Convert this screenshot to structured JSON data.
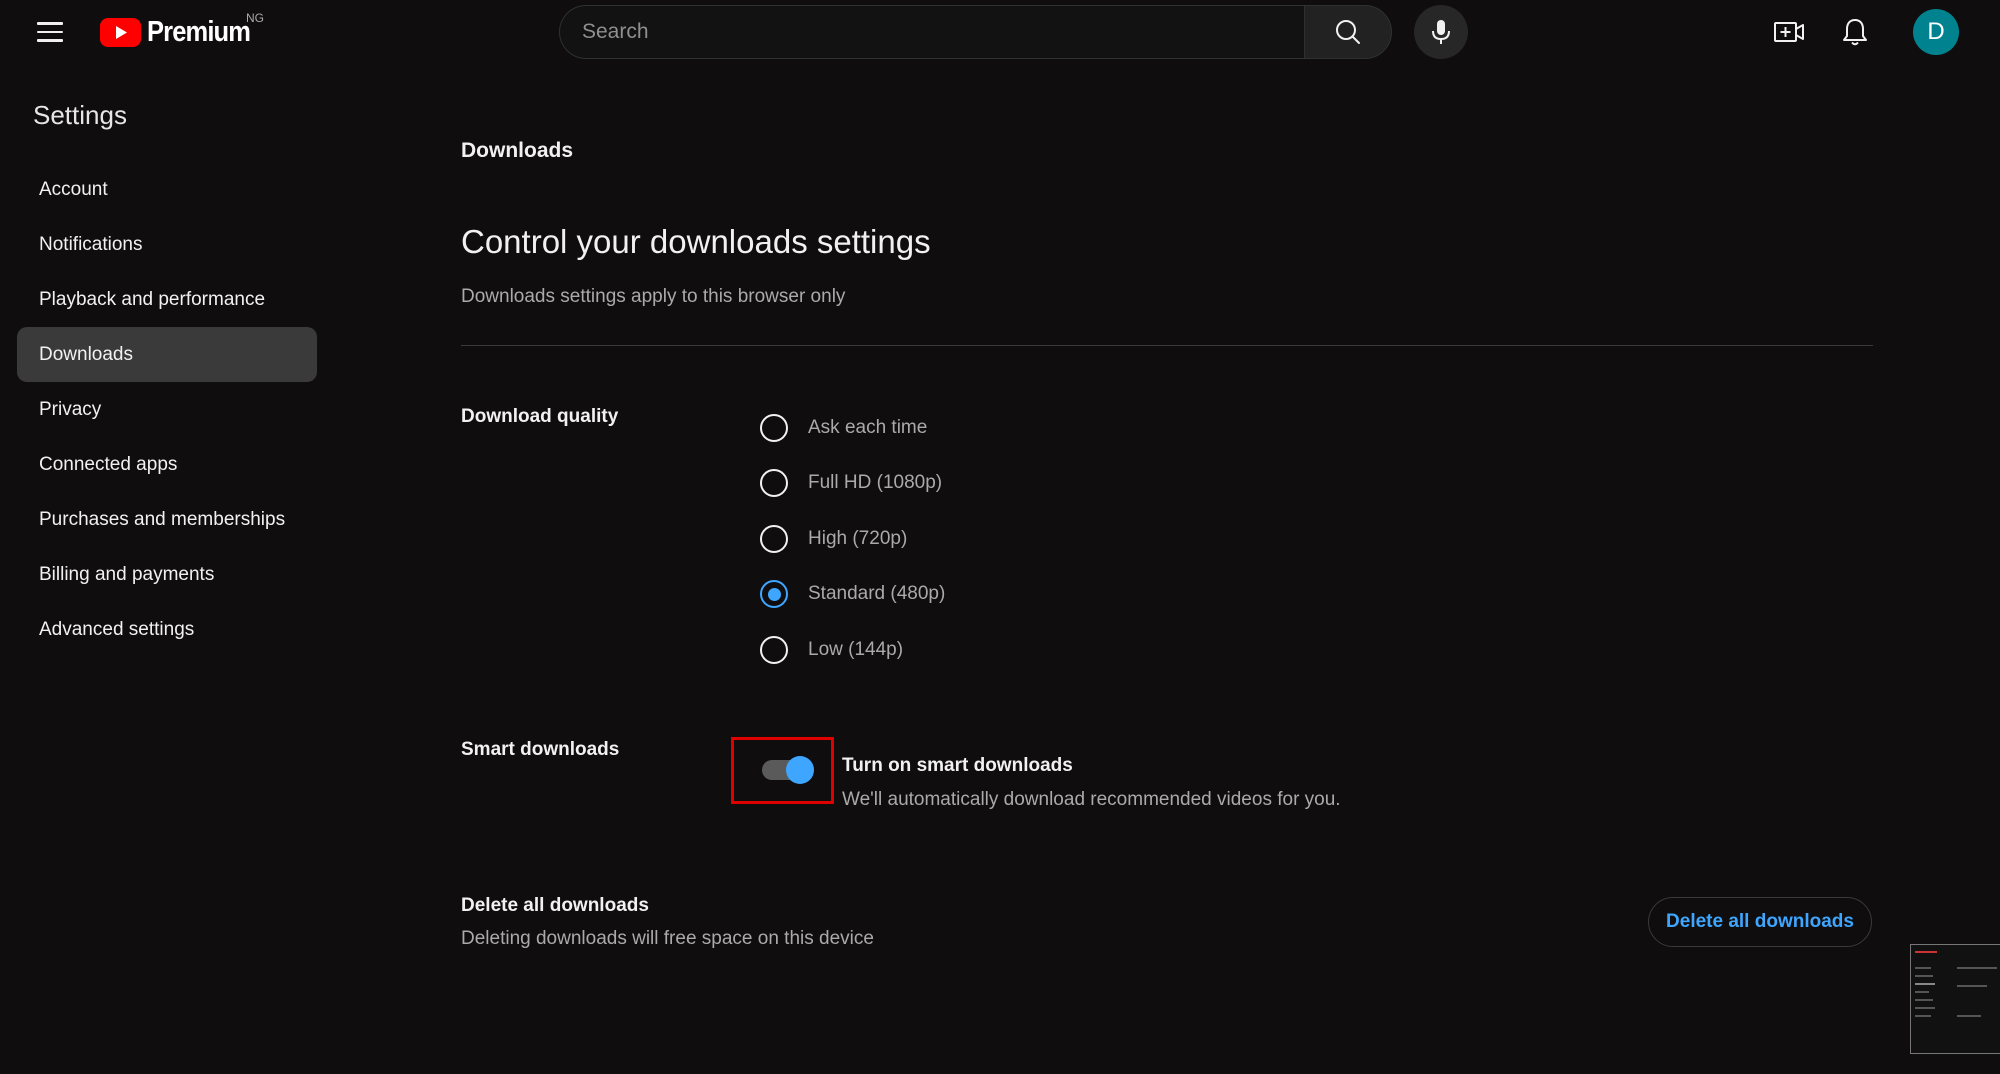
{
  "header": {
    "logo_text": "Premium",
    "country_code": "NG",
    "search_placeholder": "Search",
    "avatar_letter": "D",
    "brand_color": "#ff0000",
    "avatar_color": "#00838f"
  },
  "sidebar": {
    "title": "Settings",
    "items": [
      {
        "label": "Account"
      },
      {
        "label": "Notifications"
      },
      {
        "label": "Playback and performance"
      },
      {
        "label": "Downloads"
      },
      {
        "label": "Privacy"
      },
      {
        "label": "Connected apps"
      },
      {
        "label": "Purchases and memberships"
      },
      {
        "label": "Billing and payments"
      },
      {
        "label": "Advanced settings"
      }
    ],
    "active": "Downloads"
  },
  "main": {
    "page_heading": "Downloads",
    "title": "Control your downloads settings",
    "subtitle": "Downloads settings apply to this browser only",
    "download_quality": {
      "label": "Download quality",
      "options": [
        {
          "label": "Ask each time"
        },
        {
          "label": "Full HD (1080p)"
        },
        {
          "label": "High (720p)"
        },
        {
          "label": "Standard (480p)"
        },
        {
          "label": "Low (144p)"
        }
      ],
      "selected": "Standard (480p)"
    },
    "smart_downloads": {
      "label": "Smart downloads",
      "toggle_title": "Turn on smart downloads",
      "toggle_description": "We'll automatically download recommended videos for you.",
      "enabled": true,
      "accent_color": "#3ea6ff"
    },
    "delete_all": {
      "label": "Delete all downloads",
      "description": "Deleting downloads will free space on this device",
      "button_label": "Delete all downloads"
    }
  }
}
